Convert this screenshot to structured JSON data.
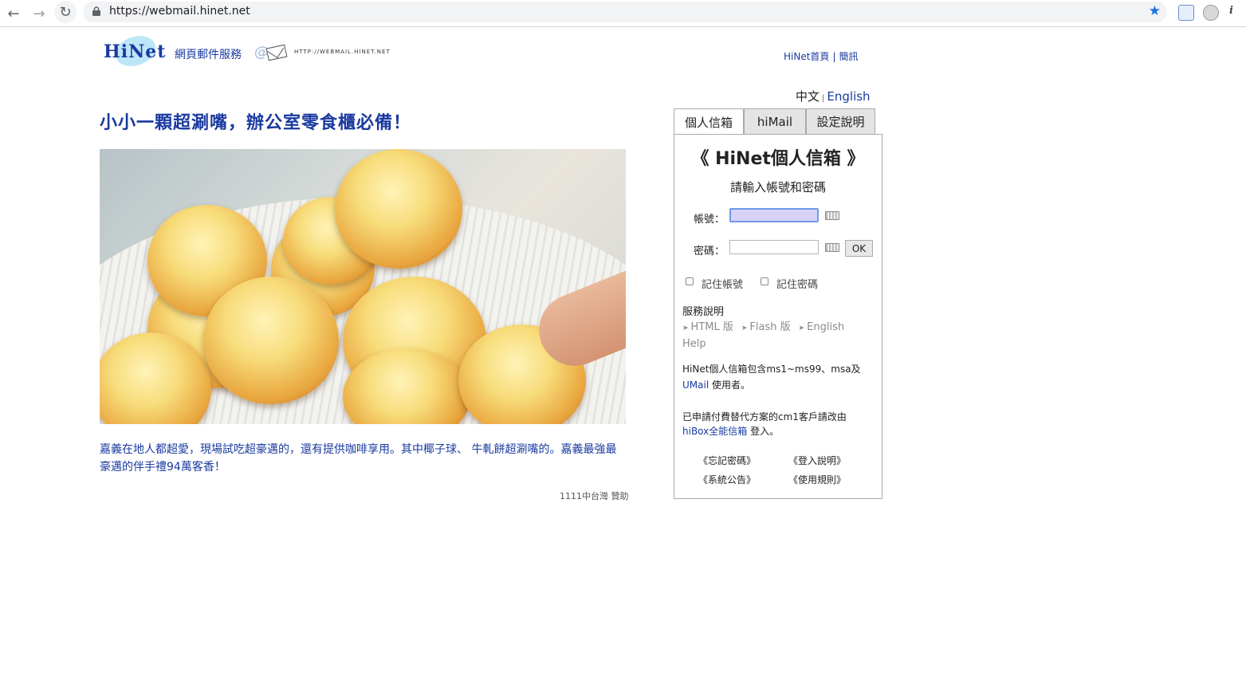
{
  "browser": {
    "url": "https://webmail.hinet.net"
  },
  "header": {
    "logo_text": "HiNet",
    "service_name": "網頁郵件服務",
    "slogan": "HTTP://WEBMAIL.HINET.NET",
    "links": [
      "HiNet首頁",
      "簡訊"
    ]
  },
  "article": {
    "headline": "小小一顆超涮嘴，辦公室零食櫃必備！",
    "description": "嘉義在地人都超愛，現場試吃超豪邁的，還有提供咖啡享用。其中椰子球、 牛軋餅超涮嘴的。嘉義最強最豪邁的伴手禮94萬客香！",
    "sponsor": "1111中台灣 贊助"
  },
  "login": {
    "lang_zh": "中文",
    "lang_en": "English",
    "tabs": [
      "個人信箱",
      "hiMail",
      "設定說明"
    ],
    "title": "《 HiNet個人信箱 》",
    "subtitle": "請輸入帳號和密碼",
    "account_label": "帳號：",
    "password_label": "密碼：",
    "account_value": "",
    "password_value": "",
    "ok_label": "OK",
    "remember_account": "記住帳號",
    "remember_password": "記住密碼",
    "service_title": "服務說明",
    "service_links": [
      "HTML 版",
      "Flash 版",
      "English"
    ],
    "help": "Help",
    "info1_text": "HiNet個人信箱包含ms1~ms99、msa及",
    "info1_link": "UMail",
    "info1_tail": " 使用者。",
    "info2_text": "已申請付費替代方案的cm1客戶請改由",
    "info2_link": "hiBox全能信箱",
    "info2_tail": " 登入。",
    "footer_links": [
      "《忘記密碼》",
      "《登入說明》",
      "《系統公告》",
      "《使用規則》"
    ]
  },
  "colors": {
    "brand_blue": "#1a3aa0",
    "focus_input": "#d8d2f7",
    "chrome_star": "#1a73e8"
  }
}
